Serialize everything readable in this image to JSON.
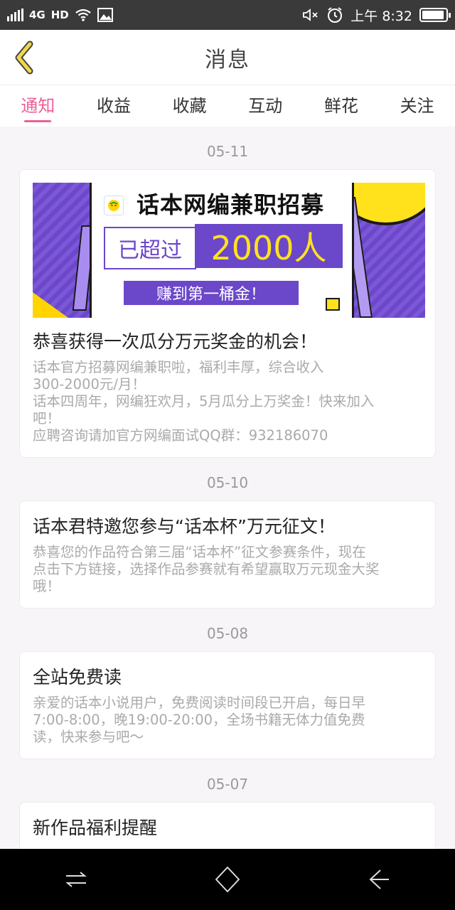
{
  "status_bar": {
    "network": "4G",
    "hd": "HD",
    "time": "上午 8:32"
  },
  "header": {
    "title": "消息"
  },
  "tabs": [
    {
      "label": "通知",
      "active": true
    },
    {
      "label": "收益",
      "active": false
    },
    {
      "label": "收藏",
      "active": false
    },
    {
      "label": "互动",
      "active": false
    },
    {
      "label": "鲜花",
      "active": false
    },
    {
      "label": "关注",
      "active": false
    }
  ],
  "banner": {
    "headline": "话本网编兼职招募",
    "box_left": "已超过",
    "box_right": "2000人",
    "button": "赚到第一桶金！"
  },
  "messages": [
    {
      "date": "05-11",
      "title": "恭喜获得一次瓜分万元奖金的机会！",
      "body": "话本官方招募网编兼职啦，福利丰厚，综合收入\n300-2000元/月！\n话本四周年，网编狂欢月，5月瓜分上万奖金！快来加入\n吧！\n应聘咨询请加官方网编面试QQ群：932186070"
    },
    {
      "date": "05-10",
      "title": "话本君特邀您参与“话本杯”万元征文！",
      "body": "恭喜您的作品符合第三届“话本杯”征文参赛条件，现在\n点击下方链接，选择作品参赛就有希望赢取万元现金大奖\n哦！"
    },
    {
      "date": "05-08",
      "title": "全站免费读",
      "body": "亲爱的话本小说用户，免费阅读时间段已开启，每日早\n7:00-8:00，晚19:00-20:00，全场书籍无体力值免费\n读，快来参与吧～"
    },
    {
      "date": "05-07",
      "title": "新作品福利提醒",
      "body": ""
    }
  ],
  "colors": {
    "accent": "#ef5f97",
    "back_arrow": "#f2d74a",
    "banner_purple": "#6b47c9",
    "banner_yellow": "#ffe21c"
  },
  "icons": {
    "back": "chevron-left-icon",
    "signal": "signal-icon",
    "wifi": "wifi-icon",
    "image": "image-icon",
    "mute": "mute-icon",
    "alarm": "alarm-icon",
    "battery": "battery-icon",
    "nav_menu": "menu-swap-icon",
    "nav_home": "home-icon",
    "nav_back": "back-icon"
  },
  "battery_level": 0.95
}
